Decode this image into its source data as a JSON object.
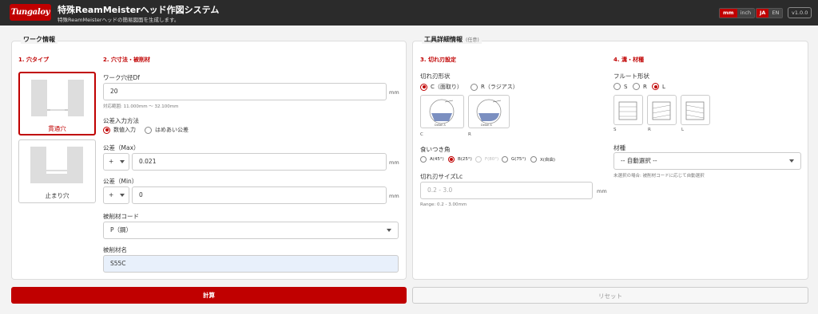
{
  "header": {
    "logo": "Tungaloy",
    "title": "特殊ReamMeisterヘッド作図システム",
    "subtitle": "特殊ReamMeisterヘッドの簡易図面を生成します。",
    "unit_mm": "mm",
    "unit_inch": "inch",
    "lang_ja": "JA",
    "lang_en": "EN",
    "version": "v1.0.0"
  },
  "work": {
    "title": "ワーク情報",
    "step1": "1. 穴タイプ",
    "step2": "2. 穴寸法・被削材",
    "hole_types": [
      {
        "label": "貫通穴",
        "selected": true
      },
      {
        "label": "止まり穴",
        "selected": false
      }
    ],
    "diameter_label": "ワーク穴径Df",
    "diameter_value": "20",
    "diameter_unit": "mm",
    "range_hint": "対応範囲: 11.000mm 〜 32.100mm",
    "tol_method_label": "公差入力方法",
    "tol_methods": [
      {
        "label": "数値入力",
        "selected": true
      },
      {
        "label": "はめあい公差",
        "selected": false
      }
    ],
    "tol_max_label": "公差（Max）",
    "tol_max_sign": "+",
    "tol_max_value": "0.021",
    "tol_min_label": "公差（Min）",
    "tol_min_sign": "+",
    "tol_min_value": "0",
    "tol_unit": "mm",
    "material_code_label": "被削材コード",
    "material_code_value": "P（鋼）",
    "material_name_label": "被削材名",
    "material_name_value": "S55C"
  },
  "tool": {
    "title": "工具詳細情報",
    "optional": "(任意)",
    "step3": "3. 切れ刃設定",
    "step4": "4. 溝・材種",
    "edge_shape_label": "切れ刃形状",
    "edge_shapes": [
      {
        "label": "C（面取り）",
        "selected": true
      },
      {
        "label": "R（ラジアス）",
        "selected": false
      }
    ],
    "edge_captions": [
      "C",
      "R"
    ],
    "detail_text": "Detail A",
    "bite_angle_label": "食いつき角",
    "bite_angles": [
      {
        "label": "A(45°)",
        "selected": false,
        "disabled": false
      },
      {
        "label": "B(25°)",
        "selected": true,
        "disabled": false
      },
      {
        "label": "F(80°)",
        "selected": false,
        "disabled": true
      },
      {
        "label": "G(75°)",
        "selected": false,
        "disabled": false
      },
      {
        "label": "X(自由)",
        "selected": false,
        "disabled": false
      }
    ],
    "edge_size_label": "切れ刃サイズLc",
    "edge_size_placeholder": "0.2 - 3.0",
    "edge_size_unit": "mm",
    "edge_size_range": "Range: 0.2 - 3.00mm",
    "flute_label": "フルート形状",
    "flutes": [
      {
        "label": "S",
        "selected": false
      },
      {
        "label": "R",
        "selected": false
      },
      {
        "label": "L",
        "selected": true
      }
    ],
    "flute_captions": [
      "S",
      "R",
      "L"
    ],
    "grade_label": "材種",
    "grade_value": "-- 自動選択 --",
    "grade_hint": "未選択の場合: 被削材コードに応じて自動選択"
  },
  "actions": {
    "calculate": "計算",
    "reset": "リセット"
  },
  "colors": {
    "accent": "#c00000",
    "header_bg": "#2b2b2b",
    "input_highlight": "#e8f0fb"
  }
}
